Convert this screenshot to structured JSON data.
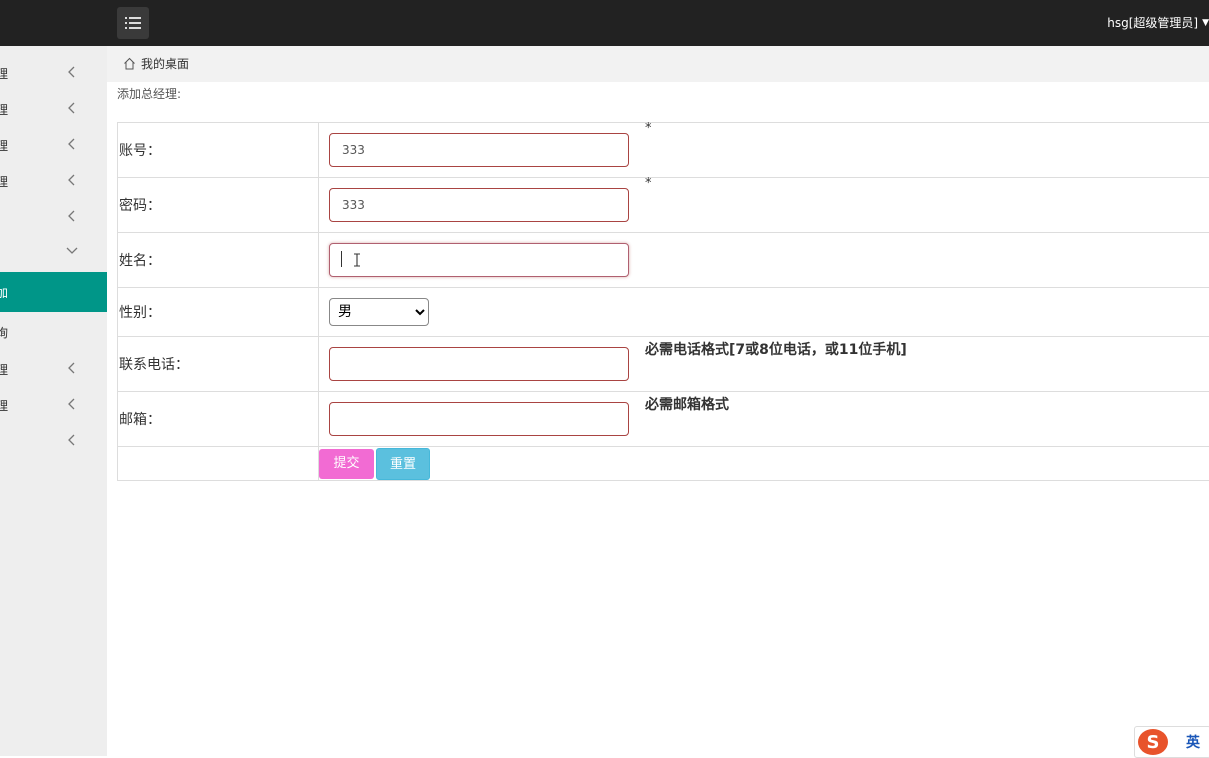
{
  "header": {
    "user_label": "hsg[超级管理员]"
  },
  "breadcrumb": {
    "home_label": "我的桌面"
  },
  "sidebar": {
    "items": [
      {
        "label": "理",
        "chevron": "left"
      },
      {
        "label": "理",
        "chevron": "left"
      },
      {
        "label": "理",
        "chevron": "left"
      },
      {
        "label": "理",
        "chevron": "left"
      },
      {
        "label": "",
        "chevron": "left"
      },
      {
        "label": "",
        "chevron": "down"
      },
      {
        "label": "加",
        "chevron": "none",
        "active": true
      },
      {
        "label": "询",
        "chevron": "none"
      },
      {
        "label": "理",
        "chevron": "left"
      },
      {
        "label": "理",
        "chevron": "left"
      },
      {
        "label": "",
        "chevron": "left"
      }
    ],
    "active_color": "#009688"
  },
  "page": {
    "title": "添加总经理:"
  },
  "form": {
    "account": {
      "label": "账号：",
      "value": "333",
      "required_mark": "*"
    },
    "password": {
      "label": "密码：",
      "value": "333",
      "required_mark": "*"
    },
    "name": {
      "label": "姓名：",
      "value": ""
    },
    "gender": {
      "label": "性别：",
      "selected": "男"
    },
    "phone": {
      "label": "联系电话：",
      "value": "",
      "hint": "必需电话格式[7或8位电话，或11位手机]"
    },
    "email": {
      "label": "邮箱：",
      "value": "",
      "hint": "必需邮箱格式"
    },
    "submit_label": "提交",
    "reset_label": "重置"
  },
  "ime": {
    "logo": "S",
    "lang": "英"
  },
  "colors": {
    "topbar": "#222222",
    "submit": "#f26bd3",
    "reset": "#5bc0de",
    "input_border": "#a94442"
  }
}
